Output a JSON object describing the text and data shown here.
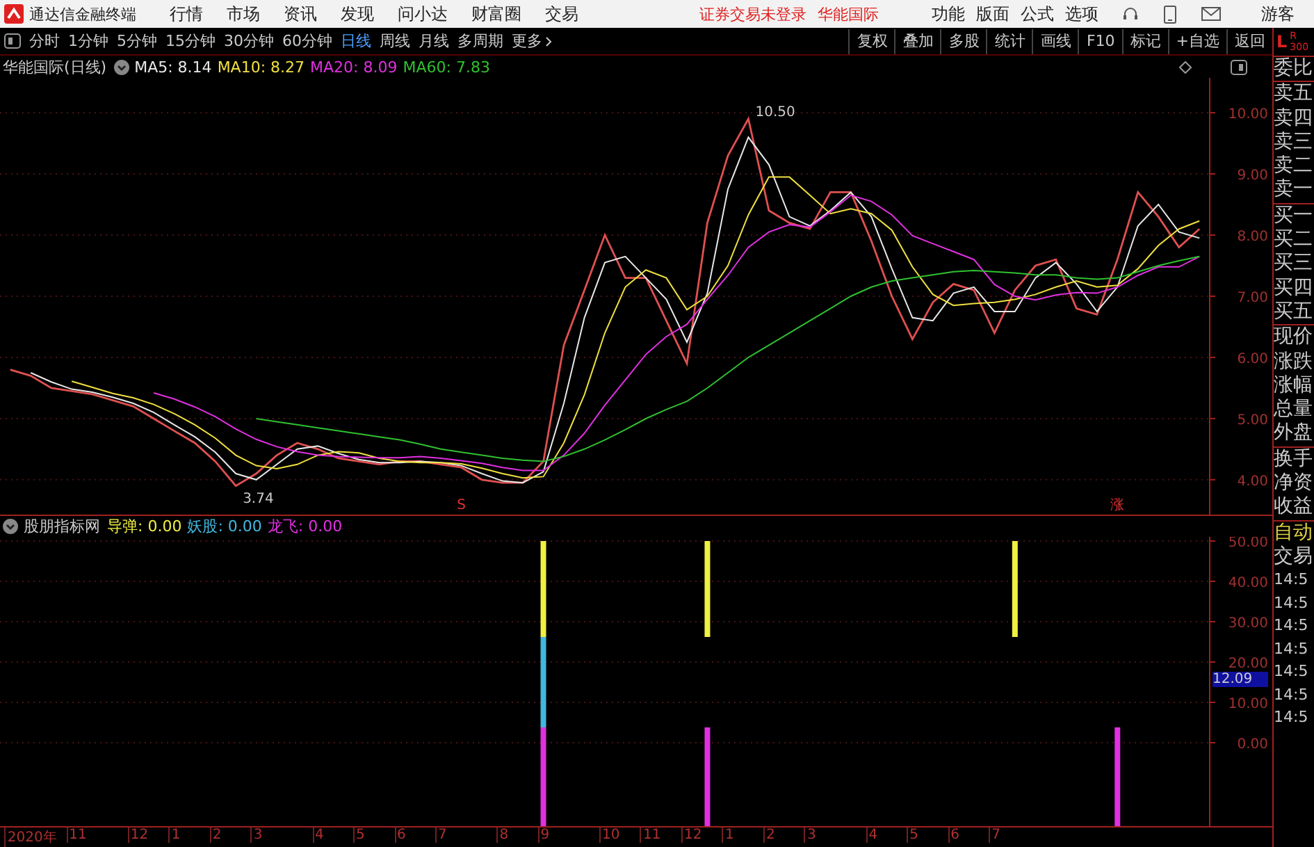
{
  "app_bar": {
    "title": "通达信金融终端",
    "menus": [
      "行情",
      "市场",
      "资讯",
      "发现",
      "问小达",
      "财富圈",
      "交易"
    ],
    "notices": [
      "证券交易未登录",
      "华能国际"
    ],
    "tools": [
      "功能",
      "版面",
      "公式",
      "选项"
    ],
    "user": "游客"
  },
  "toolbar": {
    "periods": [
      {
        "label": "分时",
        "selected": false
      },
      {
        "label": "1分钟",
        "selected": false
      },
      {
        "label": "5分钟",
        "selected": false
      },
      {
        "label": "15分钟",
        "selected": false
      },
      {
        "label": "30分钟",
        "selected": false
      },
      {
        "label": "60分钟",
        "selected": false
      },
      {
        "label": "日线",
        "selected": true
      },
      {
        "label": "周线",
        "selected": false
      },
      {
        "label": "月线",
        "selected": false
      },
      {
        "label": "多周期",
        "selected": false
      },
      {
        "label": "更多",
        "selected": false
      }
    ],
    "buttons": [
      "复权",
      "叠加",
      "多股",
      "统计",
      "画线",
      "F10",
      "标记",
      "+自选",
      "返回"
    ]
  },
  "price_chart": {
    "title": "华能国际(日线)",
    "legend": [
      {
        "label": "MA5: 8.14",
        "color": "#e8e8e8"
      },
      {
        "label": "MA10: 8.27",
        "color": "#f0e040"
      },
      {
        "label": "MA20: 8.09",
        "color": "#e030e0"
      },
      {
        "label": "MA60: 7.83",
        "color": "#30c030"
      }
    ],
    "signal_marks": [
      "S",
      "涨"
    ],
    "chart_data": {
      "type": "line",
      "ylim": [
        3.43,
        10.57
      ],
      "grid": true,
      "categories": [
        null,
        null,
        null,
        null,
        null,
        null,
        null,
        null,
        null,
        null,
        null,
        null,
        null,
        null,
        null,
        null,
        null,
        null,
        null,
        null,
        null,
        null,
        null,
        null,
        null,
        null,
        null,
        null,
        null,
        null,
        null,
        null,
        null,
        null,
        null,
        null,
        null,
        null,
        null,
        null,
        null,
        null,
        null,
        null,
        null,
        null,
        null,
        null,
        null,
        null,
        null,
        null,
        null,
        null,
        null,
        null,
        null,
        null,
        null
      ],
      "series": [
        {
          "color": "#e05050",
          "values": [
            5.8,
            5.7,
            5.5,
            5.45,
            5.4,
            5.3,
            5.2,
            5.0,
            4.8,
            4.6,
            4.3,
            3.9,
            4.1,
            4.4,
            4.6,
            4.5,
            4.35,
            4.3,
            4.25,
            4.3,
            4.3,
            4.25,
            4.2,
            4.0,
            3.95,
            3.95,
            4.3,
            6.2,
            7.1,
            8.0,
            7.3,
            7.3,
            6.6,
            5.9,
            8.2,
            9.3,
            9.9,
            8.4,
            8.2,
            8.1,
            8.7,
            8.7,
            7.9,
            7.0,
            6.3,
            6.9,
            7.2,
            7.1,
            6.4,
            7.1,
            7.5,
            7.6,
            6.8,
            6.7,
            7.6,
            8.7,
            8.3,
            7.8,
            8.1
          ]
        },
        {
          "color": "#e8e8e8",
          "values": [
            null,
            5.75,
            5.6,
            5.48,
            5.43,
            5.35,
            5.25,
            5.1,
            4.9,
            4.7,
            4.45,
            4.1,
            4.0,
            4.25,
            4.5,
            4.55,
            4.43,
            4.33,
            4.28,
            4.28,
            4.3,
            4.28,
            4.23,
            4.1,
            3.98,
            3.95,
            4.13,
            5.25,
            6.65,
            7.55,
            7.65,
            7.3,
            6.95,
            6.25,
            7.05,
            8.75,
            9.6,
            9.15,
            8.3,
            8.15,
            8.4,
            8.7,
            8.3,
            7.45,
            6.65,
            6.6,
            7.05,
            7.15,
            6.75,
            6.75,
            7.3,
            7.55,
            7.2,
            6.75,
            7.15,
            8.15,
            8.5,
            8.05,
            7.95
          ]
        },
        {
          "color": "#f0e040",
          "values": [
            null,
            null,
            null,
            5.61,
            5.51,
            5.41,
            5.34,
            5.23,
            5.08,
            4.9,
            4.68,
            4.4,
            4.23,
            4.18,
            4.25,
            4.4,
            4.46,
            4.44,
            4.35,
            4.3,
            4.28,
            4.28,
            4.26,
            4.19,
            4.1,
            4.03,
            4.05,
            4.6,
            5.39,
            6.4,
            7.15,
            7.43,
            7.3,
            6.78,
            7.0,
            7.5,
            8.33,
            8.95,
            8.95,
            8.65,
            8.35,
            8.43,
            8.35,
            8.08,
            7.48,
            7.03,
            6.85,
            6.88,
            6.9,
            6.95,
            7.03,
            7.15,
            7.25,
            7.15,
            7.18,
            7.45,
            7.83,
            8.1,
            8.23
          ]
        },
        {
          "color": "#e030e0",
          "values": [
            null,
            null,
            null,
            null,
            null,
            null,
            null,
            5.42,
            5.32,
            5.19,
            5.03,
            4.83,
            4.66,
            4.54,
            4.46,
            4.4,
            4.38,
            4.37,
            4.36,
            4.36,
            4.38,
            4.35,
            4.31,
            4.27,
            4.2,
            4.15,
            4.15,
            4.4,
            4.76,
            5.22,
            5.63,
            6.05,
            6.34,
            6.54,
            6.95,
            7.34,
            7.8,
            8.05,
            8.17,
            8.13,
            8.38,
            8.65,
            8.55,
            8.33,
            7.99,
            7.86,
            7.73,
            7.6,
            7.19,
            7.0,
            6.94,
            7.02,
            7.06,
            7.05,
            7.15,
            7.34,
            7.48,
            7.48,
            7.65
          ]
        },
        {
          "color": "#30c030",
          "values": [
            null,
            null,
            null,
            null,
            null,
            null,
            null,
            null,
            null,
            null,
            null,
            null,
            5.0,
            4.95,
            4.9,
            4.85,
            4.8,
            4.75,
            4.7,
            4.65,
            4.58,
            4.5,
            4.45,
            4.4,
            4.35,
            4.32,
            4.3,
            4.38,
            4.5,
            4.65,
            4.82,
            5.0,
            5.15,
            5.28,
            5.5,
            5.75,
            6.0,
            6.2,
            6.4,
            6.6,
            6.8,
            7.0,
            7.15,
            7.25,
            7.3,
            7.35,
            7.4,
            7.42,
            7.4,
            7.38,
            7.35,
            7.35,
            7.3,
            7.28,
            7.3,
            7.4,
            7.5,
            7.58,
            7.65
          ]
        }
      ],
      "yticks": [
        {
          "value": 10,
          "label": "10.00"
        },
        {
          "value": 9,
          "label": "9.00"
        },
        {
          "value": 8,
          "label": "8.00"
        },
        {
          "value": 7,
          "label": "7.00"
        },
        {
          "value": 6,
          "label": "6.00"
        },
        {
          "value": 5,
          "label": "5.00"
        },
        {
          "value": 4,
          "label": "4.00"
        }
      ],
      "annotations": [
        "10.50",
        "3.74"
      ]
    }
  },
  "indicator_chart": {
    "title": "股朋指标网",
    "legend": [
      {
        "label": "导弹: 0.00",
        "color": "#f0f040"
      },
      {
        "label": "妖股: 0.00",
        "color": "#40b8e0"
      },
      {
        "label": "龙飞: 0.00",
        "color": "#e030e0"
      }
    ],
    "cursor_value": "12.09",
    "axis_labels": [
      "50.00",
      "40.00",
      "30.00",
      "20.00",
      "10.00",
      "0.00"
    ],
    "signals": [
      {
        "top": true,
        "middle": true,
        "bottom": true
      },
      {
        "top": true,
        "bottom": true
      },
      {
        "top": true
      },
      {
        "bottom": true
      }
    ],
    "time_labels": [
      "2020年",
      "11",
      "12",
      "1",
      "2",
      "3",
      "4",
      "5",
      "6",
      "7",
      "8",
      "9",
      "10",
      "11",
      "12",
      "1",
      "2",
      "3",
      "4",
      "5",
      "6",
      "7"
    ]
  },
  "quote_panel": {
    "badge": "L",
    "badge_top": "R",
    "badge_sub": "300",
    "groups": [
      [
        "委比"
      ],
      [
        "卖五",
        "卖四",
        "卖三",
        "卖二",
        "卖一"
      ],
      [
        "买一",
        "买二",
        "买三",
        "买四",
        "买五"
      ],
      [
        "现价",
        "涨跌",
        "涨幅",
        "总量",
        "外盘"
      ],
      [
        "换手",
        "净资",
        "收益"
      ]
    ],
    "trade": {
      "mode": "自动",
      "label": "交易",
      "times": [
        "14:5",
        "14:5",
        "14:5",
        "14:5",
        "14:5",
        "14:5",
        "14:5"
      ]
    }
  }
}
